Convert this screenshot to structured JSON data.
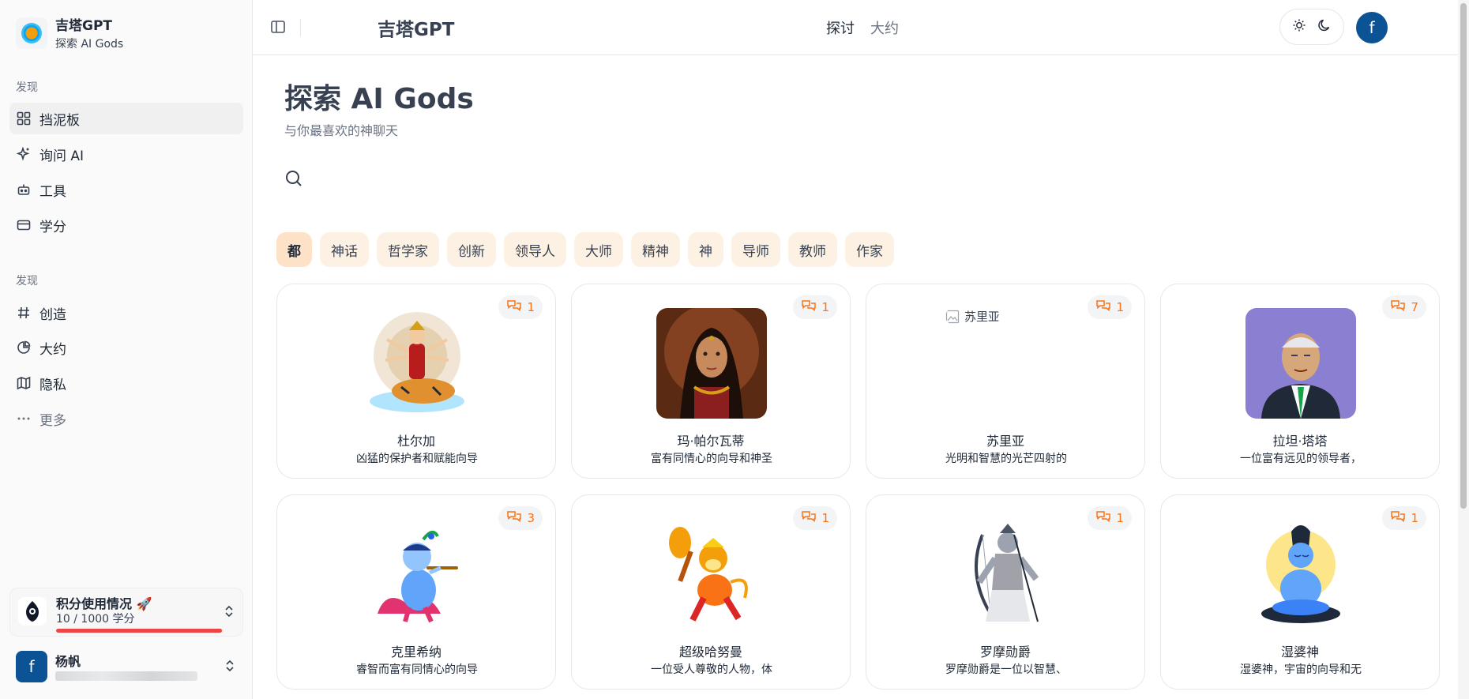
{
  "brand": {
    "title": "吉塔GPT",
    "subtitle": "探索 AI Gods"
  },
  "sidebar": {
    "section1_label": "发现",
    "items1": [
      {
        "label": "挡泥板",
        "icon": "grid-icon",
        "active": true
      },
      {
        "label": "询问 AI",
        "icon": "sparkle-icon"
      },
      {
        "label": "工具",
        "icon": "robot-icon"
      },
      {
        "label": "学分",
        "icon": "card-icon"
      }
    ],
    "section2_label": "发现",
    "items2": [
      {
        "label": "创造",
        "icon": "hash-icon"
      },
      {
        "label": "大约",
        "icon": "pie-icon"
      },
      {
        "label": "隐私",
        "icon": "map-icon"
      },
      {
        "label": "更多",
        "icon": "dots-icon"
      }
    ],
    "credits": {
      "title": "积分使用情况 🚀",
      "usage": "10 / 1000 学分",
      "progress": 0.99
    },
    "user": {
      "name": "杨帆",
      "avatar": "f"
    }
  },
  "topbar": {
    "title": "吉塔GPT",
    "nav": [
      "探讨",
      "大约"
    ],
    "avatar": "f"
  },
  "main": {
    "title": "探索 AI Gods",
    "subtitle": "与你最喜欢的神聊天",
    "chips": [
      "都",
      "神话",
      "哲学家",
      "创新",
      "领导人",
      "大师",
      "精神",
      "神",
      "导师",
      "教师",
      "作家"
    ]
  },
  "cards": [
    {
      "name": "杜尔加",
      "desc": "凶猛的保护者和赋能向导",
      "count": "1",
      "image": "durga-image"
    },
    {
      "name": "玛·帕尔瓦蒂",
      "desc": "富有同情心的向导和神圣",
      "count": "1",
      "image": "parvati-image"
    },
    {
      "name": "苏里亚",
      "desc": "光明和智慧的光芒四射的",
      "count": "1",
      "image": "surya-image-broken",
      "alt": "苏里亚"
    },
    {
      "name": "拉坦·塔塔",
      "desc": "一位富有远见的领导者，",
      "count": "7",
      "image": "ratan-tata-image"
    },
    {
      "name": "克里希纳",
      "desc": "睿智而富有同情心的向导",
      "count": "3",
      "image": "krishna-image"
    },
    {
      "name": "超级哈努曼",
      "desc": "一位受人尊敬的人物，体",
      "count": "1",
      "image": "hanuman-image"
    },
    {
      "name": "罗摩勋爵",
      "desc": "罗摩勋爵是一位以智慧、",
      "count": "1",
      "image": "rama-image"
    },
    {
      "name": "湿婆神",
      "desc": "湿婆神，宇宙的向导和无",
      "count": "1",
      "image": "shiva-image"
    }
  ]
}
